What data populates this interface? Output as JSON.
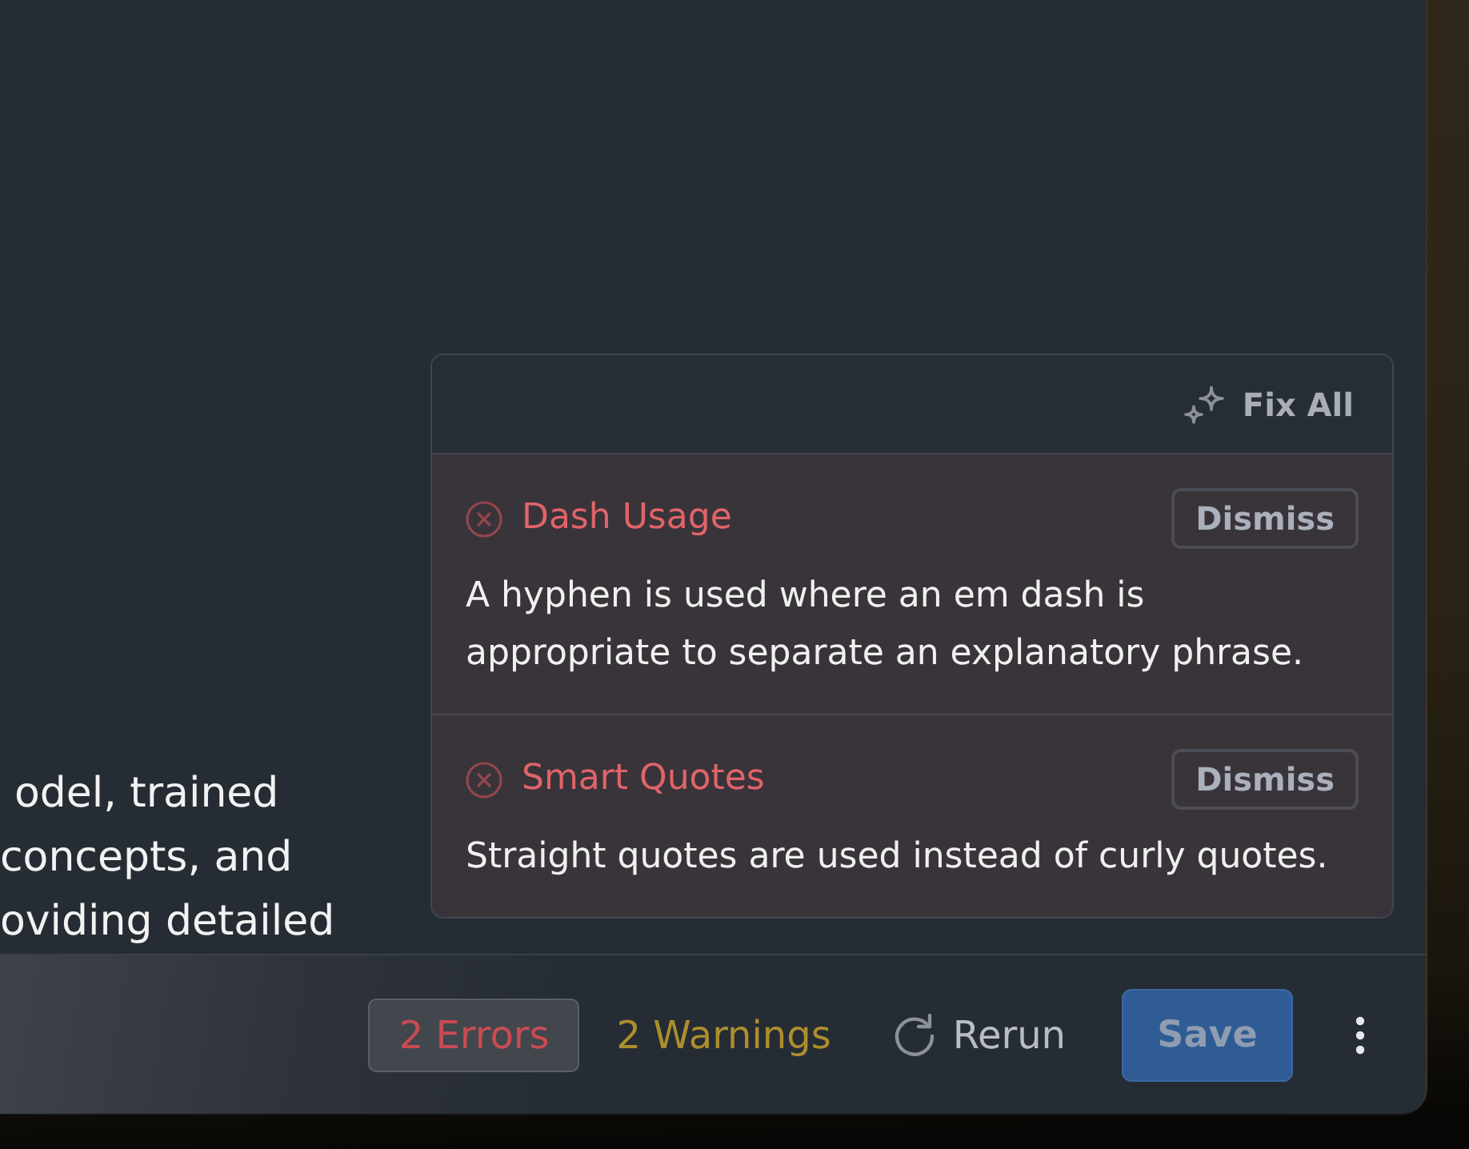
{
  "editor": {
    "lines": [
      "odel, trained",
      "concepts, and",
      "oviding detailed"
    ]
  },
  "issues_panel": {
    "fix_all": "Fix All",
    "issues": [
      {
        "kind": "error",
        "title": "Dash Usage",
        "dismiss": "Dismiss",
        "description": "A hyphen is used where an em dash is appropriate to separate an explanatory phrase."
      },
      {
        "kind": "error",
        "title": "Smart Quotes",
        "dismiss": "Dismiss",
        "description": "Straight quotes are used instead of curly quotes."
      }
    ]
  },
  "footer": {
    "filters": [
      {
        "kind": "error",
        "label": "2 Errors",
        "selected": true
      },
      {
        "kind": "warning",
        "label": "2 Warnings",
        "selected": false
      }
    ],
    "rerun": "Rerun",
    "save": {
      "label": "Save",
      "disabled": true
    }
  }
}
